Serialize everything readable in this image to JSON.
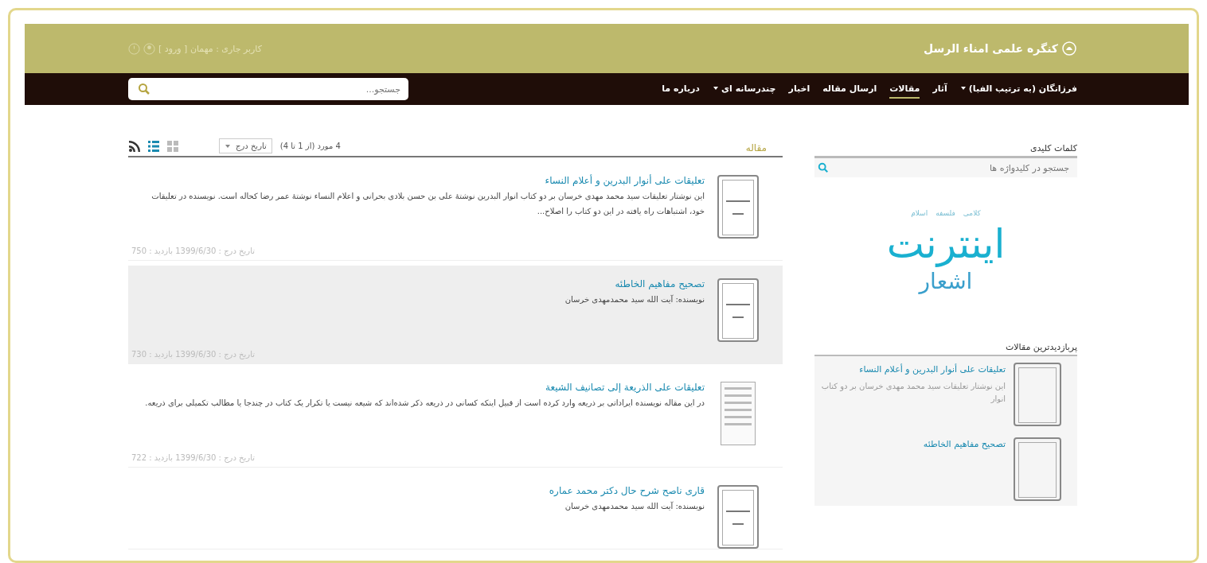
{
  "header": {
    "site_title": "کنگره علمی امناء الرسل",
    "user_status": "کاربر جاری : مهمان [ ورود ]"
  },
  "nav": {
    "items": [
      {
        "label": "فرزانگان (به ترتیب الفبا)",
        "selected": false,
        "has_menu": true
      },
      {
        "label": "آثار",
        "selected": false,
        "has_menu": false
      },
      {
        "label": "مقالات",
        "selected": true,
        "has_menu": false
      },
      {
        "label": "ارسال مقاله",
        "selected": false,
        "has_menu": false
      },
      {
        "label": "اخبار",
        "selected": false,
        "has_menu": false
      },
      {
        "label": "چندرسانه ای",
        "selected": false,
        "has_menu": true
      },
      {
        "label": "درباره ما",
        "selected": false,
        "has_menu": false
      }
    ],
    "search": {
      "placeholder": "جستجو..."
    }
  },
  "main": {
    "heading": "مقاله",
    "count": "4 مورد (از 1 تا 4)",
    "sort": {
      "value": "تاریخ درج"
    },
    "views": [
      {
        "kind": "grid",
        "selected": false
      },
      {
        "kind": "list",
        "selected": true
      },
      {
        "kind": "rss"
      }
    ],
    "articles": [
      {
        "title": "تعلیقات علی أنوار البدرین و أعلام النساء",
        "text": "این نوشتار تعلیقات سید محمد مهدی خرسان بر دو کتاب انوار البدرین نوشتهٔ علی بن حسن بلادی بحرانی و اعلام النساء نوشتهٔ عمر رضا کحاله است. نویسنده در تعلیقات خود، اشتباهات راه یافته در این دو کتاب را اصلاح...",
        "meta": "تاریخ درج : 1399/6/30 بازدید : 750",
        "highlighted": false,
        "kind": "book"
      },
      {
        "title": "تصحیح مفاهیم الخاطئه",
        "text": "نویسنده: آیت الله سید محمدمهدی خرسان",
        "meta": "تاریخ درج : 1399/6/30 بازدید : 730",
        "highlighted": true,
        "kind": "book"
      },
      {
        "title": "تعلیقات علی الذریعة إلی تصانیف الشیعة",
        "text": "در این مقاله نویسنده ایراداتی بر ذریعه وارد کرده است از قبیل اینکه کسانی در ذریعه ذکر شده‌اند که شیعه نیست یا تکرار یک کتاب در چندجا یا مطالب تکمیلی برای ذریعه.",
        "meta": "تاریخ درج : 1399/6/30 بازدید : 722",
        "highlighted": false,
        "kind": "document"
      },
      {
        "title": "قاری ناصح شرح حال دکتر محمد عماره",
        "text": "نویسنده: آیت الله سید محمدمهدی خرسان",
        "highlighted": false,
        "kind": "book"
      }
    ]
  },
  "sidebar": {
    "keywords": {
      "heading": "کلمات کلیدی",
      "search_placeholder": "جستجو در کلیدواژه ها",
      "tags": [
        {
          "label": "کلامی",
          "kind": "small"
        },
        {
          "label": "فلسفه",
          "kind": "small"
        },
        {
          "label": "اسلام",
          "kind": "small"
        },
        {
          "label": "اینترنت",
          "kind": "large"
        },
        {
          "label": "اشعار",
          "kind": "medium"
        }
      ]
    },
    "popular": {
      "heading": "پربازدیدترین مقالات",
      "items": [
        {
          "title": "تعلیقات علی أنوار البدرین و أعلام النساء",
          "text": "این نوشتار تعلیقات سید محمد مهدی خرسان بر دو کتاب انوار"
        },
        {
          "title": "تصحیح مفاهیم الخاطئه"
        }
      ]
    }
  }
}
